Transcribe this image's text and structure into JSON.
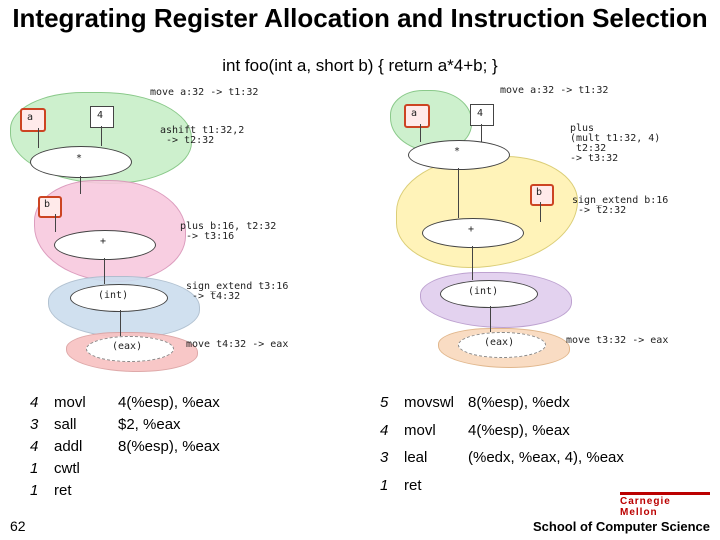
{
  "title": "Integrating Register Allocation and Instruction Selection",
  "code_snippet": "int foo(int a, short b) { return a*4+b; }",
  "diagram_labels": {
    "move_a": "move a:32 -> t1:32",
    "ashift": "ashift t1:32,2\n -> t2:32",
    "plus_b": "plus b:16, t2:32\n -> t3:16",
    "sign_ext_l": "sign_extend t3:16\n -> t4:32",
    "move_t4": "move t4:32 -> eax",
    "move_a_r": "move a:32 -> t1:32",
    "plus_r": "plus\n(mult t1:32, 4)\n t2:32\n-> t3:32",
    "sign_ext_r": "sign_extend b:16\n -> t2:32",
    "move_t3": "move t3:32 -> eax",
    "a": "a",
    "four": "4",
    "star": "*",
    "b": "b",
    "plus": "+",
    "int": "(int)",
    "eax": "(eax)"
  },
  "left_listing": {
    "rows": [
      {
        "cost": "4",
        "mnemonic": "movl",
        "operands": "4(%esp), %eax"
      },
      {
        "cost": "3",
        "mnemonic": "sall",
        "operands": "$2, %eax"
      },
      {
        "cost": "4",
        "mnemonic": "addl",
        "operands": "8(%esp), %eax"
      },
      {
        "cost": "1",
        "mnemonic": "cwtl",
        "operands": ""
      },
      {
        "cost": "1",
        "mnemonic": "ret",
        "operands": ""
      }
    ]
  },
  "right_listing": {
    "rows": [
      {
        "cost": "5",
        "mnemonic": "movswl",
        "operands": "8(%esp), %edx"
      },
      {
        "cost": "4",
        "mnemonic": "movl",
        "operands": "4(%esp), %eax"
      },
      {
        "cost": "3",
        "mnemonic": "leal",
        "operands": "(%edx, %eax, 4), %eax"
      },
      {
        "cost": "1",
        "mnemonic": "ret",
        "operands": ""
      }
    ]
  },
  "slide_number": "62",
  "footer": "School of Computer Science",
  "logo_text": "Carnegie Mellon"
}
